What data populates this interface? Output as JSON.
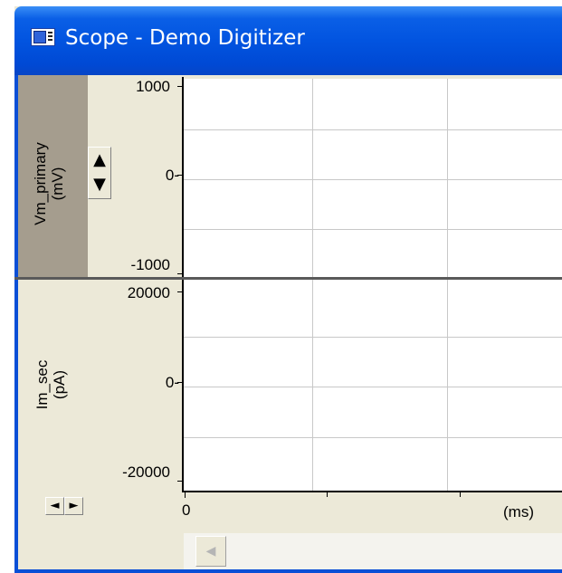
{
  "window": {
    "title": "Scope - Demo Digitizer",
    "titlebar_color": "#0254e0"
  },
  "icons": {
    "app_icon": "scope-window-icon",
    "scale_up": "triangle-up-icon",
    "scale_down": "triangle-down-icon",
    "scroll_left": "triangle-left-icon",
    "scroll_right": "triangle-right-icon"
  },
  "channels": [
    {
      "name": "Vm_primary",
      "unit": "(mV)",
      "selected": true,
      "ticks": {
        "top": "1000",
        "mid": "0-",
        "bottom": "-1000"
      }
    },
    {
      "name": "Im_sec",
      "unit": "(pA)",
      "selected": false,
      "ticks": {
        "top": "20000",
        "mid": "0-",
        "bottom": "-20000"
      }
    }
  ],
  "x_axis": {
    "start_label": "0",
    "unit_label": "(ms)"
  },
  "glyphs": {
    "up": "▲",
    "down": "▼",
    "left": "◄",
    "right": "►",
    "scroll_left": "◀"
  }
}
